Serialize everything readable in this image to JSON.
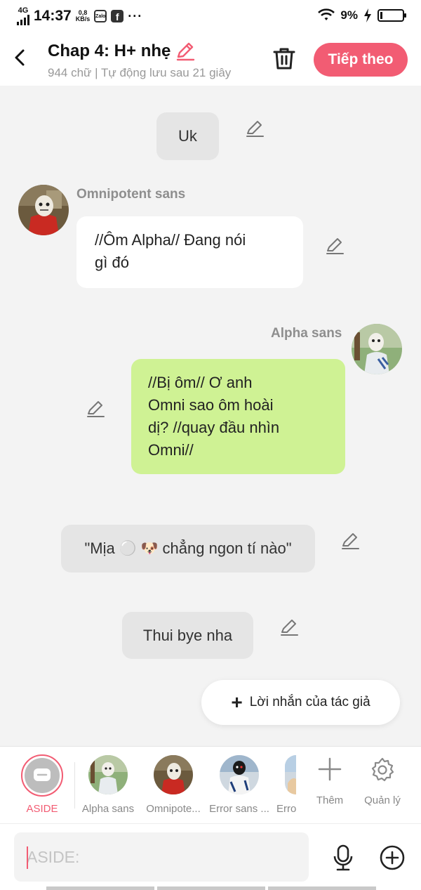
{
  "status_bar": {
    "network": "4G",
    "time": "14:37",
    "speed_value": "0,8",
    "speed_unit": "KB/s",
    "zalo_label": "Zalo",
    "facebook_label": "f",
    "more": "···",
    "battery": "9%",
    "battery_level": 0.09
  },
  "header": {
    "title": "Chap 4: H+ nhẹ",
    "subtitle": "944 chữ | Tự động lưu sau 21 giây",
    "next_button": "Tiếp theo",
    "accent_color": "#f25c73"
  },
  "messages": [
    {
      "type": "aside",
      "text": "Uk"
    },
    {
      "type": "left",
      "speaker": "Omnipotent sans",
      "line1": "//Ôm Alpha// Đang nói",
      "line2": "gì đó"
    },
    {
      "type": "right",
      "speaker": "Alpha sans",
      "lines": [
        "//Bị ôm// Ơ anh",
        "Omni sao ôm hoài",
        "dị? //quay đầu nhìn",
        "Omni//"
      ]
    },
    {
      "type": "aside",
      "prefix": "\"Mịa",
      "emoji1": "⚪",
      "emoji2": "🐶",
      "suffix": "chẳng ngon tí nào\""
    },
    {
      "type": "aside",
      "text": "Thui bye nha"
    }
  ],
  "author_note": {
    "plus": "+",
    "label": "Lời nhắn của tác giả"
  },
  "characters": {
    "aside_label": "ASIDE",
    "items": [
      {
        "label": "Alpha sans"
      },
      {
        "label": "Omnipote..."
      },
      {
        "label": "Error sans ..."
      },
      {
        "label": "Erro"
      }
    ],
    "add_label": "Thêm",
    "manage_label": "Quản lý"
  },
  "input": {
    "placeholder": "ASIDE:"
  }
}
